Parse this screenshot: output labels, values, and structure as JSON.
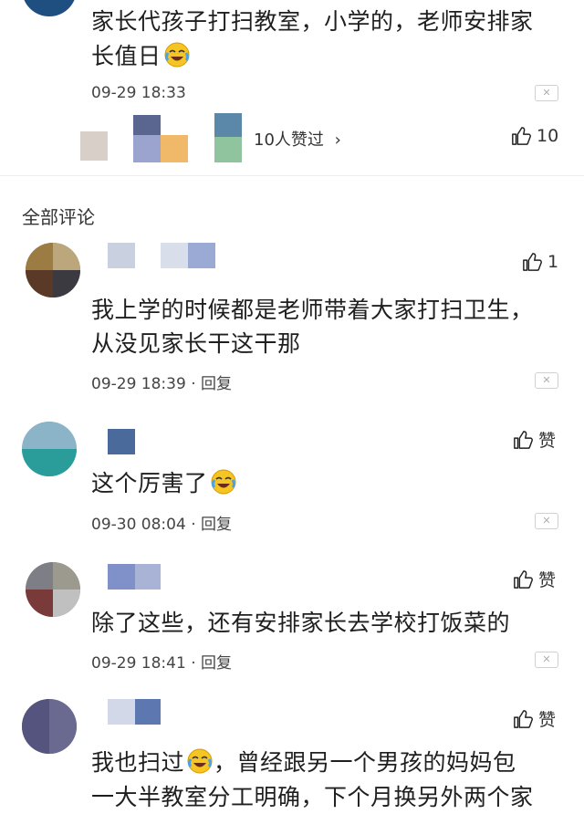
{
  "post": {
    "text": "家长代孩子打扫教室，小学的，老师安排家长值日",
    "line1": "家长代孩子打扫教室，小学的，老师安排家",
    "line2": "长值日",
    "time": "09-29 18:33",
    "likers_text": "10人赞过",
    "like_count": "10"
  },
  "section_title": "全部评论",
  "comments": [
    {
      "line1": "我上学的时候都是老师带着大家打扫卫生，",
      "line2": "从没见家长干这干那",
      "time": "09-29 18:39",
      "reply": "回复",
      "like": "1"
    },
    {
      "line1": "这个厉害了",
      "time": "09-30 08:04",
      "reply": "回复",
      "like": "赞"
    },
    {
      "line1": "除了这些，还有安排家长去学校打饭菜的",
      "time": "09-29 18:41",
      "reply": "回复",
      "like": "赞"
    },
    {
      "line1": "我也扫过",
      "line1b": "，曾经跟另一个男孩的妈妈包",
      "line2": "一大半教室分工明确，下个月换另外两个家",
      "like": "赞"
    }
  ],
  "icons": {
    "like": "thumbs-up-icon",
    "emoji": "laughing-crying-emoji-icon",
    "close": "close-icon",
    "chevron": "chevron-right-icon"
  },
  "colors": {
    "background": "#ffffff",
    "text": "#1f1f1f",
    "meta": "#444444",
    "divider": "#eeeeee"
  }
}
